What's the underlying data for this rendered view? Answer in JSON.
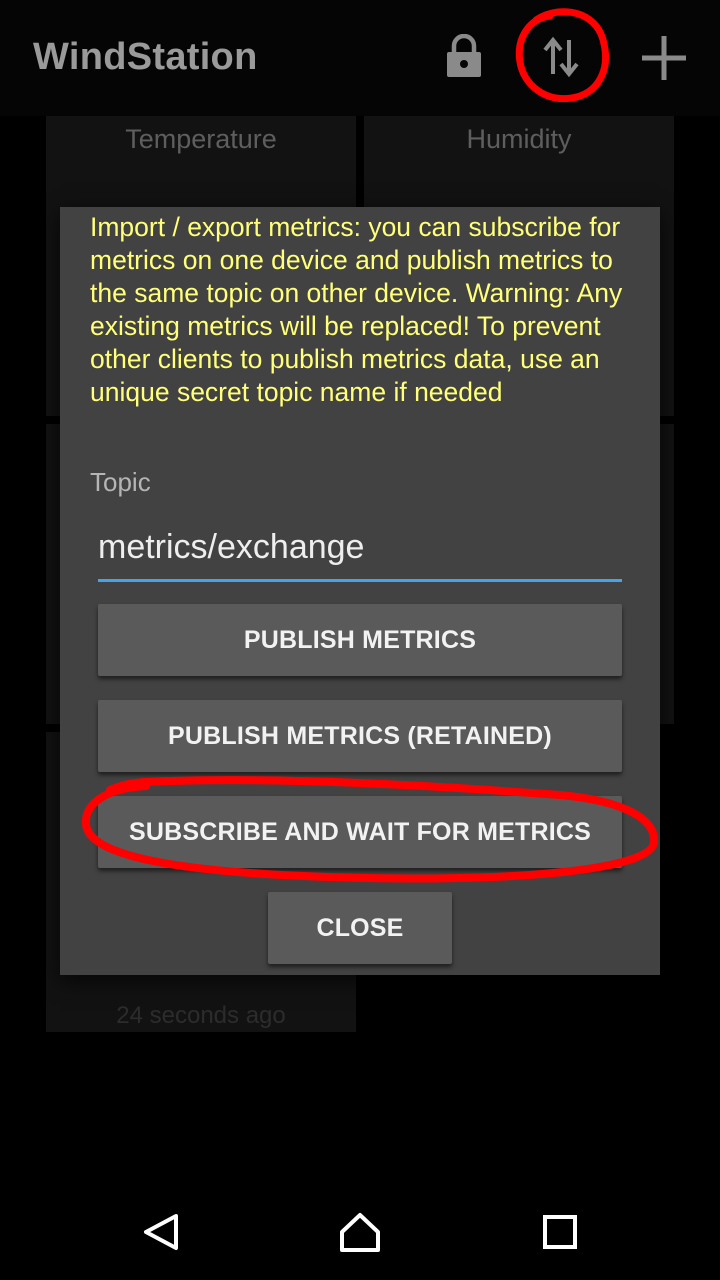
{
  "app": {
    "title": "WindStation"
  },
  "toolbar": {
    "lock_icon": "lock-icon",
    "sync_icon": "swap-vertical-icon",
    "add_icon": "add-icon"
  },
  "tiles": [
    {
      "label": "Temperature"
    },
    {
      "label": "Humidity"
    }
  ],
  "tile_footer": "24 seconds ago",
  "dialog": {
    "message": "Import / export metrics: you can subscribe for metrics on one device and publish metrics to the same topic on other device. Warning: Any existing metrics will be replaced! To prevent other clients to publish metrics data, use an unique secret topic name if needed",
    "topic_label": "Topic",
    "topic_value": "metrics/exchange",
    "publish_label": "PUBLISH METRICS",
    "publish_retained_label": "PUBLISH METRICS (RETAINED)",
    "subscribe_label": "SUBSCRIBE AND WAIT FOR METRICS",
    "close_label": "CLOSE"
  },
  "colors": {
    "message_text": "#ffff7a",
    "input_underline": "#44a4e8",
    "annotation": "#ff0000"
  },
  "navbar": {
    "back_icon": "back-icon",
    "home_icon": "home-icon",
    "recents_icon": "recents-icon"
  }
}
